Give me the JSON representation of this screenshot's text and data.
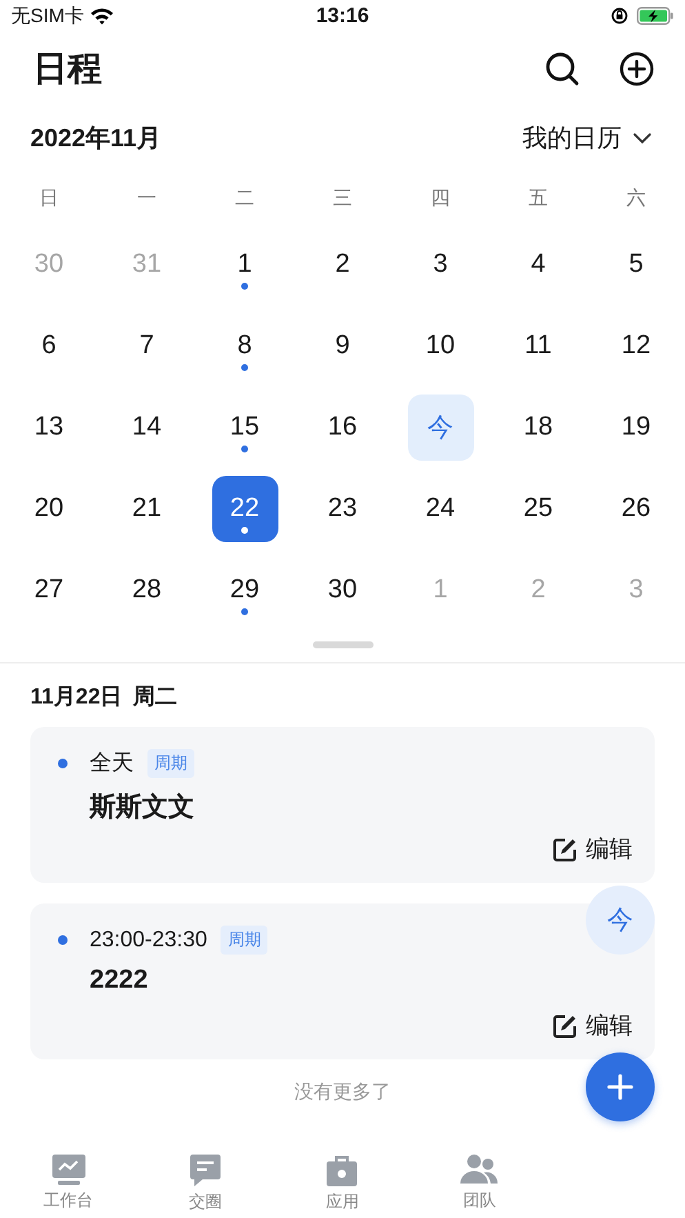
{
  "status_bar": {
    "carrier": "无SIM卡",
    "time": "13:16"
  },
  "header": {
    "title": "日程"
  },
  "calendar": {
    "month": "2022年11月",
    "calendar_picker": "我的日历",
    "weekdays": [
      "日",
      "一",
      "二",
      "三",
      "四",
      "五",
      "六"
    ],
    "weeks": [
      [
        {
          "day": "30",
          "in_month": false,
          "has_event": false,
          "today": false,
          "selected": false
        },
        {
          "day": "31",
          "in_month": false,
          "has_event": false,
          "today": false,
          "selected": false
        },
        {
          "day": "1",
          "in_month": true,
          "has_event": true,
          "today": false,
          "selected": false
        },
        {
          "day": "2",
          "in_month": true,
          "has_event": false,
          "today": false,
          "selected": false
        },
        {
          "day": "3",
          "in_month": true,
          "has_event": false,
          "today": false,
          "selected": false
        },
        {
          "day": "4",
          "in_month": true,
          "has_event": false,
          "today": false,
          "selected": false
        },
        {
          "day": "5",
          "in_month": true,
          "has_event": false,
          "today": false,
          "selected": false
        }
      ],
      [
        {
          "day": "6",
          "in_month": true,
          "has_event": false,
          "today": false,
          "selected": false
        },
        {
          "day": "7",
          "in_month": true,
          "has_event": false,
          "today": false,
          "selected": false
        },
        {
          "day": "8",
          "in_month": true,
          "has_event": true,
          "today": false,
          "selected": false
        },
        {
          "day": "9",
          "in_month": true,
          "has_event": false,
          "today": false,
          "selected": false
        },
        {
          "day": "10",
          "in_month": true,
          "has_event": false,
          "today": false,
          "selected": false
        },
        {
          "day": "11",
          "in_month": true,
          "has_event": false,
          "today": false,
          "selected": false
        },
        {
          "day": "12",
          "in_month": true,
          "has_event": false,
          "today": false,
          "selected": false
        }
      ],
      [
        {
          "day": "13",
          "in_month": true,
          "has_event": false,
          "today": false,
          "selected": false
        },
        {
          "day": "14",
          "in_month": true,
          "has_event": false,
          "today": false,
          "selected": false
        },
        {
          "day": "15",
          "in_month": true,
          "has_event": true,
          "today": false,
          "selected": false
        },
        {
          "day": "16",
          "in_month": true,
          "has_event": false,
          "today": false,
          "selected": false
        },
        {
          "day": "今",
          "in_month": true,
          "has_event": false,
          "today": true,
          "selected": false
        },
        {
          "day": "18",
          "in_month": true,
          "has_event": false,
          "today": false,
          "selected": false
        },
        {
          "day": "19",
          "in_month": true,
          "has_event": false,
          "today": false,
          "selected": false
        }
      ],
      [
        {
          "day": "20",
          "in_month": true,
          "has_event": false,
          "today": false,
          "selected": false
        },
        {
          "day": "21",
          "in_month": true,
          "has_event": false,
          "today": false,
          "selected": false
        },
        {
          "day": "22",
          "in_month": true,
          "has_event": true,
          "today": false,
          "selected": true
        },
        {
          "day": "23",
          "in_month": true,
          "has_event": false,
          "today": false,
          "selected": false
        },
        {
          "day": "24",
          "in_month": true,
          "has_event": false,
          "today": false,
          "selected": false
        },
        {
          "day": "25",
          "in_month": true,
          "has_event": false,
          "today": false,
          "selected": false
        },
        {
          "day": "26",
          "in_month": true,
          "has_event": false,
          "today": false,
          "selected": false
        }
      ],
      [
        {
          "day": "27",
          "in_month": true,
          "has_event": false,
          "today": false,
          "selected": false
        },
        {
          "day": "28",
          "in_month": true,
          "has_event": false,
          "today": false,
          "selected": false
        },
        {
          "day": "29",
          "in_month": true,
          "has_event": true,
          "today": false,
          "selected": false
        },
        {
          "day": "30",
          "in_month": true,
          "has_event": false,
          "today": false,
          "selected": false
        },
        {
          "day": "1",
          "in_month": false,
          "has_event": false,
          "today": false,
          "selected": false
        },
        {
          "day": "2",
          "in_month": false,
          "has_event": false,
          "today": false,
          "selected": false
        },
        {
          "day": "3",
          "in_month": false,
          "has_event": false,
          "today": false,
          "selected": false
        }
      ]
    ]
  },
  "agenda": {
    "date": "11月22日",
    "weekday": "周二",
    "events": [
      {
        "time": "全天",
        "tag": "周期",
        "title": "斯斯文文",
        "edit": "编辑"
      },
      {
        "time": "23:00-23:30",
        "tag": "周期",
        "title": "2222",
        "edit": "编辑"
      }
    ],
    "end_text": "没有更多了"
  },
  "today_button": "今",
  "tab_bar": [
    {
      "label": "工作台",
      "selected": false
    },
    {
      "label": "交圈",
      "selected": false
    },
    {
      "label": "应用",
      "selected": false
    },
    {
      "label": "团队",
      "selected": false
    }
  ]
}
